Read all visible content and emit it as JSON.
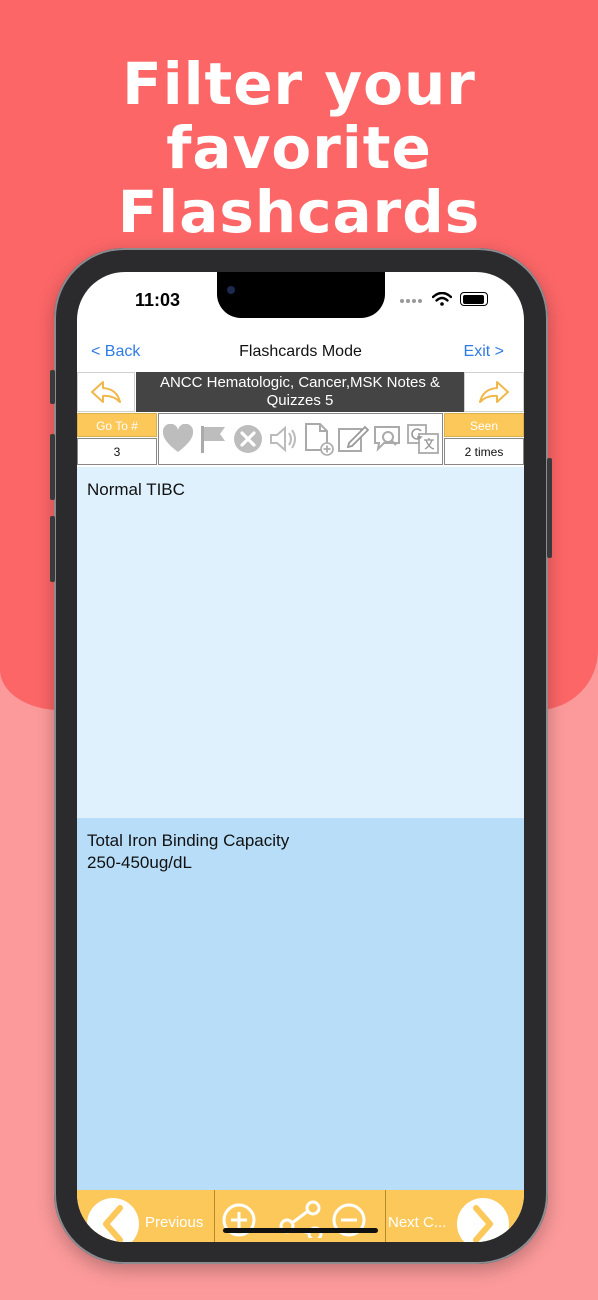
{
  "headline": {
    "line1": "Filter your favorite",
    "line2": "Flashcards"
  },
  "status_bar": {
    "time": "11:03"
  },
  "nav": {
    "back_label": "< Back",
    "title": "Flashcards Mode",
    "exit_label": "Exit >"
  },
  "deck": {
    "title": "ANCC  Hematologic, Cancer,MSK Notes & Quizzes 5"
  },
  "toolbar": {
    "goto_label": "Go To #",
    "goto_value": "3",
    "seen_label": "Seen",
    "seen_value": "2 times",
    "icons": [
      "heart-icon",
      "flag-icon",
      "close-icon",
      "speaker-icon",
      "add-document-icon",
      "edit-icon",
      "search-comment-icon",
      "translate-icon"
    ]
  },
  "card": {
    "front": "Normal TIBC",
    "back": "Total Iron Binding Capacity\n250-450ug/dL"
  },
  "bottom_bar": {
    "previous_label": "Previous",
    "next_label": "Next C..."
  },
  "colors": {
    "background_top": "#fc6667",
    "background_bottom": "#fc9a9b",
    "accent_yellow": "#fcc85a",
    "link_blue": "#2f7be5",
    "card_front": "#dff1fc",
    "card_back": "#b7ddf8",
    "deck_title_bg": "#444444"
  }
}
